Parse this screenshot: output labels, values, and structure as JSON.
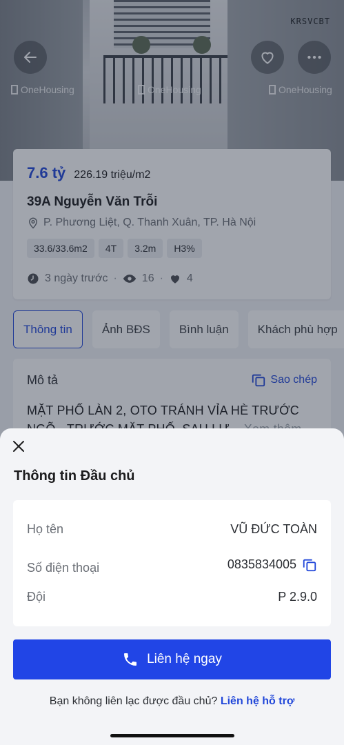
{
  "hero": {
    "watermarks": [
      "OneHousing",
      "OneHousing",
      "OneHousing"
    ],
    "tag": "KRSVCBT"
  },
  "listing": {
    "price": "7.6 tỷ",
    "price_per_m2": "226.19 triệu/m2",
    "title": "39A Nguyễn Văn Trỗi",
    "location": "P. Phương Liệt, Q. Thanh Xuân, TP. Hà Nội",
    "chips": [
      "33.6/33.6m2",
      "4T",
      "3.2m",
      "H3%"
    ],
    "posted": "3 ngày trước",
    "views": "16",
    "likes": "4"
  },
  "tabs": [
    "Thông tin",
    "Ảnh BĐS",
    "Bình luận",
    "Khách phù hợp"
  ],
  "description": {
    "title": "Mô tả",
    "copy_label": "Sao chép",
    "text_line1": "MẶT PHỐ LÀN 2, OTO TRÁNH VỈA HÈ  TRƯỚC",
    "text_line2": "NGÕ - TRƯỚC MẶT PHỐ, SAU LƯ...",
    "see_more": "Xem thêm"
  },
  "sheet": {
    "title": "Thông tin Đầu chủ",
    "rows": [
      {
        "label": "Họ tên",
        "value": "VŨ ĐỨC TOÀN"
      },
      {
        "label": "Số điện thoại",
        "value": "0835834005"
      },
      {
        "label": "Đội",
        "value": "P 2.9.0"
      }
    ],
    "contact_button": "Liên hệ ngay",
    "support_text": "Bạn không liên lạc được đầu chủ?",
    "support_link": "Liên hệ hỗ trợ"
  },
  "colors": {
    "accent": "#2147d9",
    "button": "#2145e6"
  }
}
